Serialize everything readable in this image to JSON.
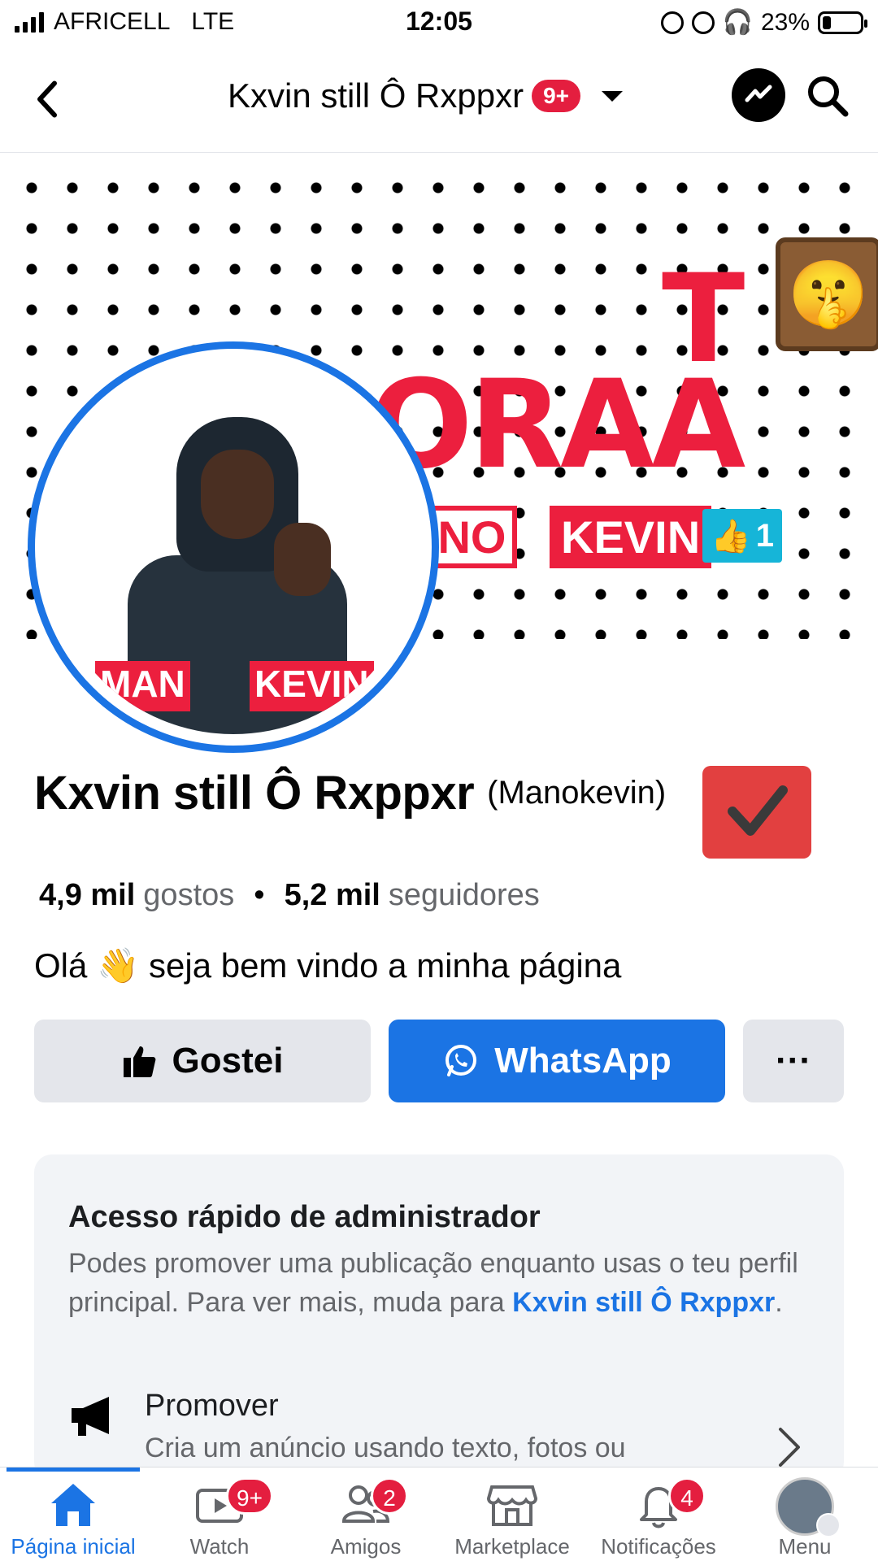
{
  "status_bar": {
    "carrier": "AFRICELL",
    "network": "LTE",
    "time": "12:05",
    "battery_percent": "23%",
    "battery_level": 0.23
  },
  "nav": {
    "page_title": "Kxvin still Ô Rxppxr",
    "notification_badge": "9+"
  },
  "cover": {
    "word_t": "T",
    "word_main": "ORAA",
    "tag_left": "ANO",
    "tag_right": "KEVIN",
    "like_count": "1"
  },
  "avatar": {
    "tag_left": "MAN",
    "tag_right": "KEVIN"
  },
  "profile": {
    "name": "Kxvin still Ô Rxppxr",
    "username": "(Manokevin)",
    "likes_count": "4,9 mil",
    "likes_label": "gostos",
    "separator": "•",
    "followers_count": "5,2 mil",
    "followers_label": "seguidores",
    "bio_prefix": "Olá",
    "bio_emoji": "👋",
    "bio_suffix": "seja bem vindo a minha página"
  },
  "actions": {
    "like_label": "Gostei",
    "whatsapp_label": "WhatsApp",
    "more_label": "···"
  },
  "admin_card": {
    "title": "Acesso rápido de administrador",
    "description": "Podes promover uma publicação enquanto usas o teu perfil principal. Para ver mais, muda para",
    "link_text": "Kxvin still Ô Rxppxr",
    "period": ".",
    "promo_title": "Promover",
    "promo_description": "Cria um anúncio usando texto, fotos ou"
  },
  "tab_bar": {
    "tabs": [
      {
        "label": "Página inicial",
        "icon": "home-icon",
        "badge": ""
      },
      {
        "label": "Watch",
        "icon": "video-icon",
        "badge": "9+"
      },
      {
        "label": "Amigos",
        "icon": "friends-icon",
        "badge": "2"
      },
      {
        "label": "Marketplace",
        "icon": "marketplace-icon",
        "badge": ""
      },
      {
        "label": "Notificações",
        "icon": "bell-icon",
        "badge": "4"
      },
      {
        "label": "Menu",
        "icon": "menu-avatar-icon",
        "badge": ""
      }
    ]
  },
  "colors": {
    "accent": "#1b74e4",
    "badge": "#e41e3f",
    "button_gray": "#e4e6eb",
    "cover_red": "#ec1f3e"
  }
}
